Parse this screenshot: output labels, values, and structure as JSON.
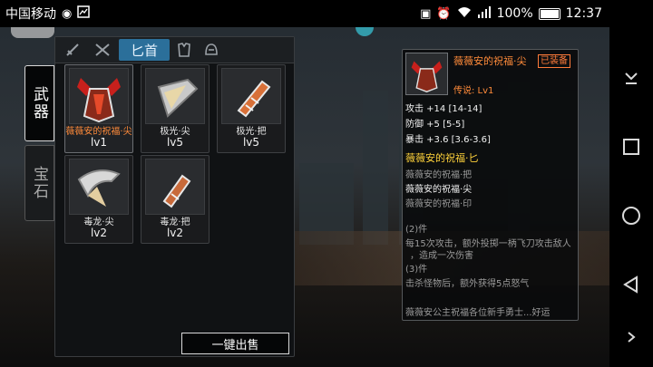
{
  "statusbar": {
    "carrier": "中国移动",
    "battery_text": "100%",
    "time": "12:37"
  },
  "side_tabs": [
    {
      "label": "武器",
      "active": true
    },
    {
      "label": "宝石",
      "active": false
    }
  ],
  "category_tabs": {
    "active_label": "匕首"
  },
  "inventory": {
    "items": [
      {
        "name": "薇薇安的祝福·尖",
        "level": "lv1",
        "highlight": true
      },
      {
        "name": "极光·尖",
        "level": "lv5",
        "highlight": false
      },
      {
        "name": "极光·把",
        "level": "lv5",
        "highlight": false
      },
      {
        "name": "毒龙·尖",
        "level": "lv2",
        "highlight": false
      },
      {
        "name": "毒龙·把",
        "level": "lv2",
        "highlight": false
      }
    ],
    "sell_all_label": "一键出售"
  },
  "detail": {
    "name": "薇薇安的祝福·尖",
    "equipped_badge": "已装备",
    "rarity": "传说:  Lv1",
    "stats": [
      {
        "label": "攻击 +14",
        "value": "[14-14]"
      },
      {
        "label": "防御 +5",
        "value": "[5-5]"
      },
      {
        "label": "暴击 +3.6",
        "value": "[3.6-3.6]"
      }
    ],
    "set_name": "薇薇安的祝福·匕",
    "set_parts": [
      {
        "name": "薇薇安的祝福·把",
        "owned": false
      },
      {
        "name": "薇薇安的祝福·尖",
        "owned": true
      },
      {
        "name": "薇薇安的祝福·印",
        "owned": false
      }
    ],
    "bonus2_title": "(2)件",
    "bonus2_line1": "每15次攻击，额外投掷一柄飞刀攻击敌人",
    "bonus2_line2": "，造成一次伤害",
    "bonus3_title": "(3)件",
    "bonus3_line1": "击杀怪物后，额外获得5点怒气",
    "flavor": "薇薇安公主祝福各位新手勇士...好运"
  },
  "colors": {
    "legendary": "#ff8b3a",
    "set_name": "#ffd23a",
    "active_tab": "#2b6f9a"
  }
}
